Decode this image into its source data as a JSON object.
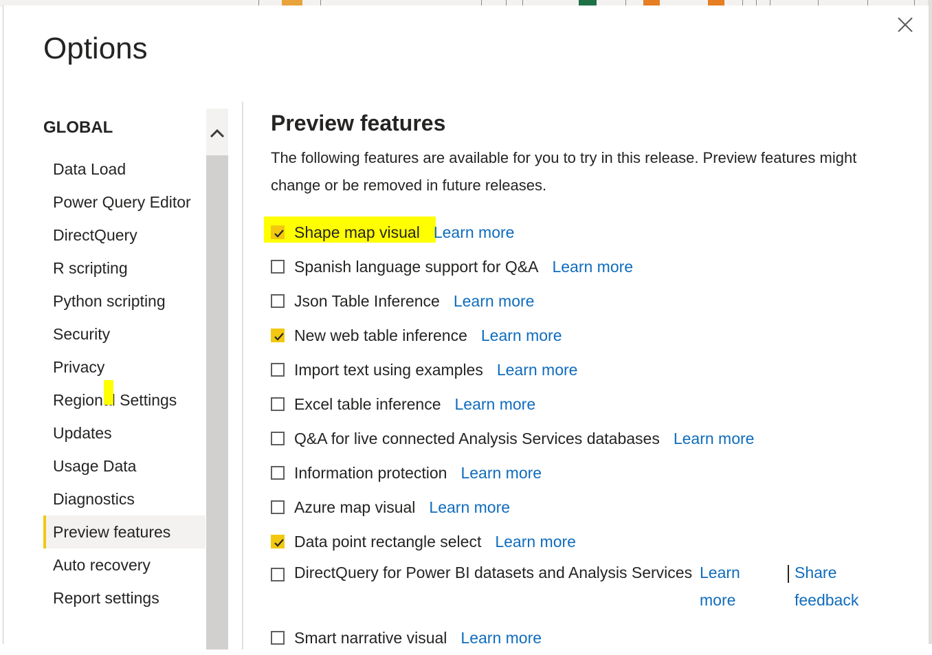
{
  "dialog": {
    "title": "Options",
    "close_icon": "close-icon"
  },
  "sidebar": {
    "heading": "GLOBAL",
    "items": [
      {
        "label": "Data Load",
        "active": false
      },
      {
        "label": "Power Query Editor",
        "active": false
      },
      {
        "label": "DirectQuery",
        "active": false
      },
      {
        "label": "R scripting",
        "active": false
      },
      {
        "label": "Python scripting",
        "active": false
      },
      {
        "label": "Security",
        "active": false
      },
      {
        "label": "Privacy",
        "active": false
      },
      {
        "label": "Regional Settings",
        "active": false
      },
      {
        "label": "Updates",
        "active": false
      },
      {
        "label": "Usage Data",
        "active": false
      },
      {
        "label": "Diagnostics",
        "active": false
      },
      {
        "label": "Preview features",
        "active": true
      },
      {
        "label": "Auto recovery",
        "active": false
      },
      {
        "label": "Report settings",
        "active": false
      }
    ],
    "scroll_up_icon": "chevron-up-icon"
  },
  "main": {
    "title": "Preview features",
    "description": "The following features are available for you to try in this release. Preview features might change or be removed in future releases.",
    "learn_more": "Learn more",
    "features": [
      {
        "label": "Shape map visual",
        "checked": true,
        "highlighted": true
      },
      {
        "label": "Spanish language support for Q&A",
        "checked": false
      },
      {
        "label": "Json Table Inference",
        "checked": false
      },
      {
        "label": "New web table inference",
        "checked": true
      },
      {
        "label": "Import text using examples",
        "checked": false
      },
      {
        "label": "Excel table inference",
        "checked": false
      },
      {
        "label": "Q&A for live connected Analysis Services databases",
        "checked": false
      },
      {
        "label": "Information protection",
        "checked": false
      },
      {
        "label": "Azure map visual",
        "checked": false
      },
      {
        "label": "Data point rectangle select",
        "checked": true
      },
      {
        "label": "DirectQuery for Power BI datasets and Analysis Services",
        "checked": false,
        "learn_link": "Learn more",
        "share_link": "Share feedback"
      },
      {
        "label": "Smart narrative visual",
        "checked": false
      }
    ]
  },
  "colors": {
    "accent": "#f2c811",
    "link": "#0f6cbd",
    "highlight": "#ffff00"
  }
}
